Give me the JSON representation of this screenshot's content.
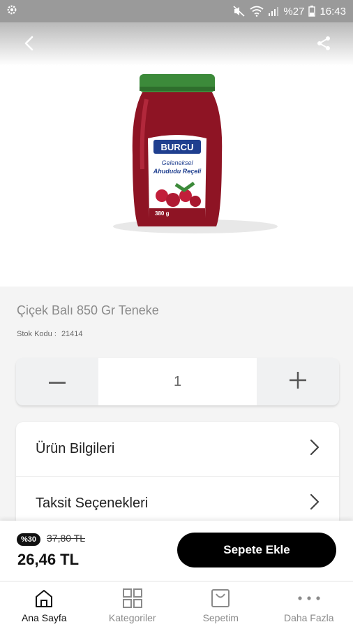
{
  "status_bar": {
    "battery": "%27",
    "time": "16:43"
  },
  "product": {
    "title": "Çiçek Balı 850 Gr Teneke",
    "stock_label": "Stok Kodu :",
    "stock_code": "21414",
    "image": {
      "brand": "BURCU",
      "line1": "Geleneksel",
      "line2": "Ahududu Reçeli",
      "weight": "380 g"
    }
  },
  "quantity": {
    "value": "1"
  },
  "info_rows": [
    {
      "label": "Ürün Bilgileri"
    },
    {
      "label": "Taksit Seçenekleri"
    }
  ],
  "pricing": {
    "discount_badge": "%30",
    "old_price": "37,80 TL",
    "new_price": "26,46 TL",
    "add_to_cart_label": "Sepete Ekle"
  },
  "bottom_nav": {
    "items": [
      {
        "label": "Ana Sayfa",
        "icon": "home-icon",
        "active": true
      },
      {
        "label": "Kategoriler",
        "icon": "grid-icon",
        "active": false
      },
      {
        "label": "Sepetim",
        "icon": "bag-icon",
        "active": false
      },
      {
        "label": "Daha Fazla",
        "icon": "more-dots-icon",
        "active": false
      }
    ]
  },
  "colors": {
    "status_bar": "#9a9a9a",
    "cart_button": "#000000",
    "page_background": "#f4f4f4",
    "jam_red": "#a4162c",
    "lid_green": "#3c8a3a"
  }
}
